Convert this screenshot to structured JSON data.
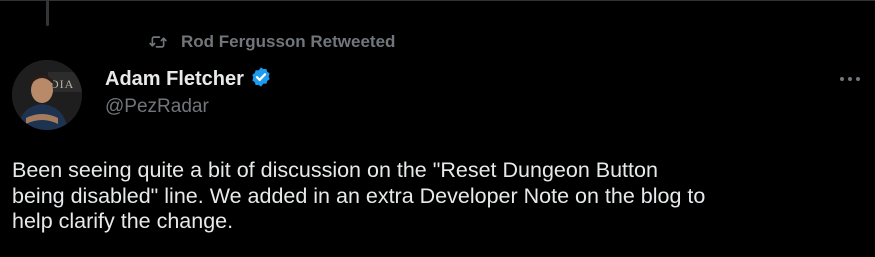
{
  "retweet": {
    "text": "Rod Fergusson Retweeted",
    "icon": "retweet-icon"
  },
  "author": {
    "display_name": "Adam Fletcher",
    "handle": "@PezRadar",
    "verified": true,
    "avatar_text": "DIA"
  },
  "tweet": {
    "text": "Been seeing quite a bit of discussion on the \"Reset Dungeon Button\nbeing disabled\" line.  We added in an extra Developer Note on the blog to\nhelp clarify the change."
  },
  "colors": {
    "background": "#000000",
    "primary_text": "#e7e9ea",
    "secondary_text": "#71767b",
    "verified_badge": "#1d9bf0"
  },
  "icons": {
    "more": "more-horizontal-icon",
    "verified": "verified-badge-icon"
  }
}
